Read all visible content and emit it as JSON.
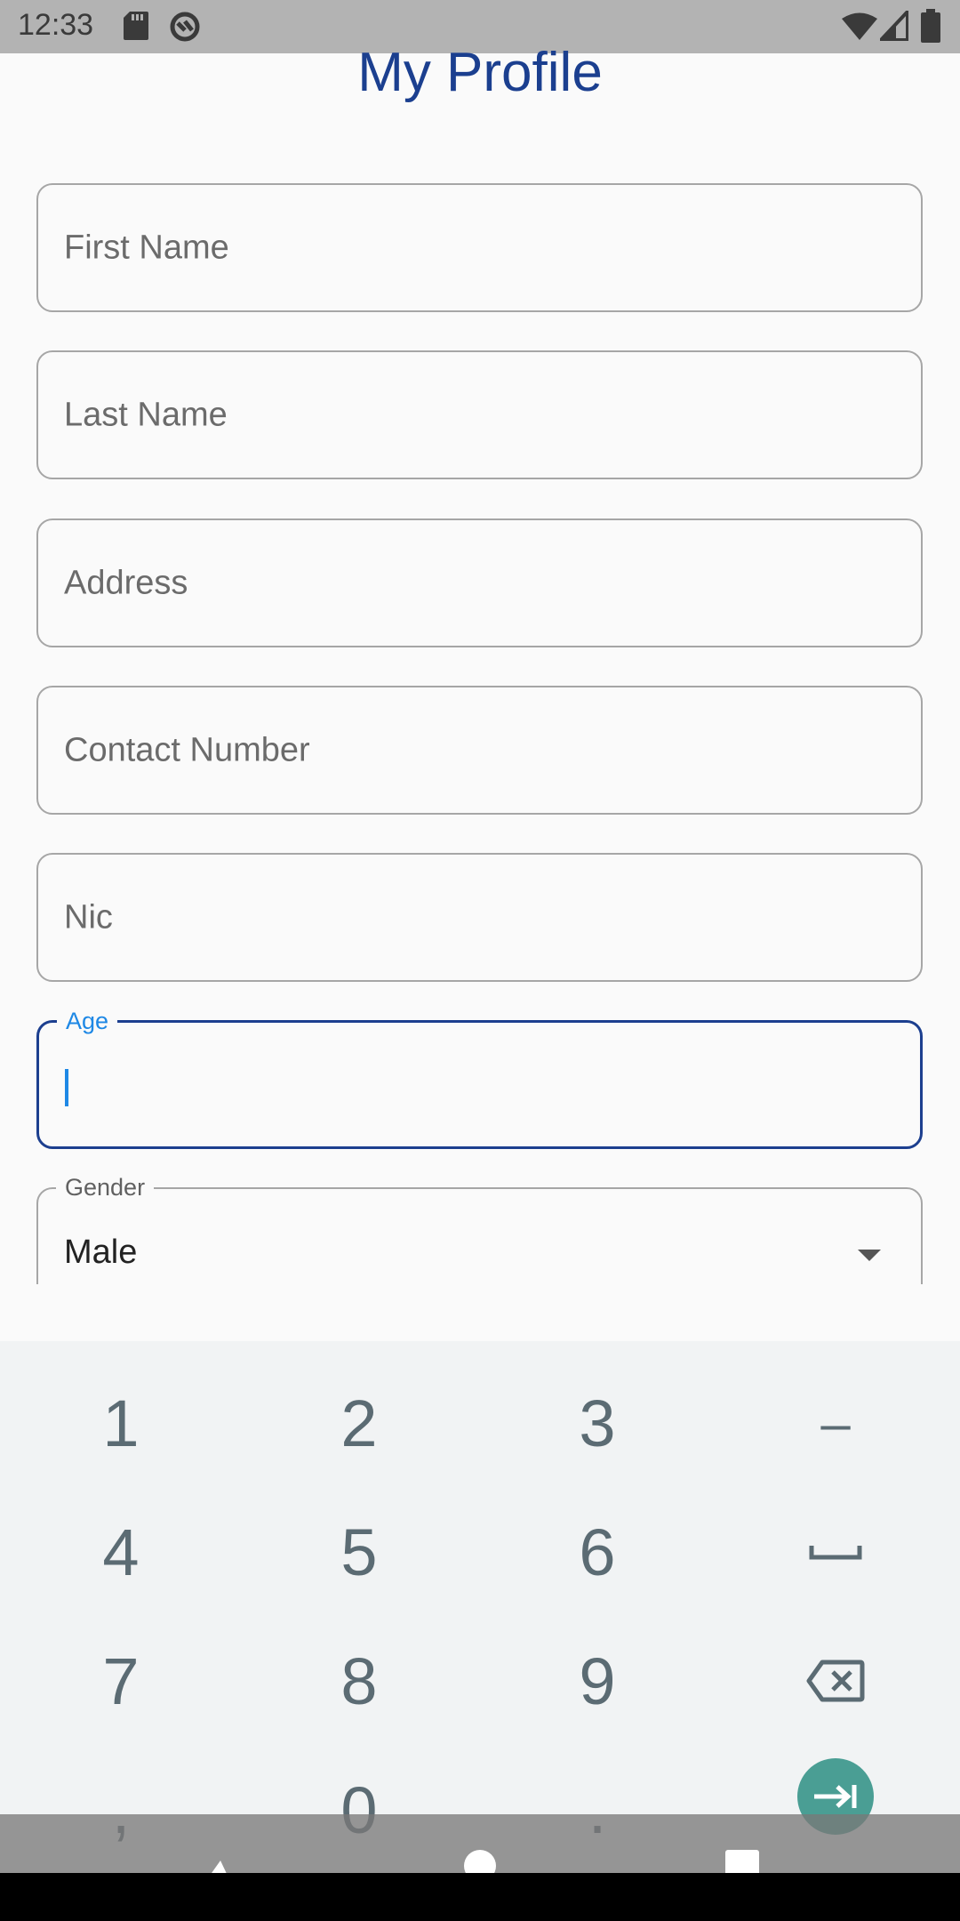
{
  "status_bar": {
    "time": "12:33",
    "icons": [
      "sd-card-icon",
      "sync-off-icon",
      "wifi-icon",
      "signal-icon",
      "battery-icon"
    ]
  },
  "page": {
    "title": "My Profile"
  },
  "form": {
    "first_name": {
      "placeholder": "First Name",
      "value": ""
    },
    "last_name": {
      "placeholder": "Last Name",
      "value": ""
    },
    "address": {
      "placeholder": "Address",
      "value": ""
    },
    "contact_number": {
      "placeholder": "Contact Number",
      "value": ""
    },
    "nic": {
      "placeholder": "Nic",
      "value": ""
    },
    "age": {
      "label": "Age",
      "value": ""
    },
    "gender": {
      "label": "Gender",
      "value": "Male"
    }
  },
  "keyboard": {
    "rows": [
      [
        "1",
        "2",
        "3",
        "–"
      ],
      [
        "4",
        "5",
        "6",
        "space-icon"
      ],
      [
        "7",
        "8",
        "9",
        "backspace-icon"
      ],
      [
        ",",
        "0",
        ".",
        "enter-icon"
      ]
    ],
    "accent_color": "#4a9e94"
  },
  "nav_bar": {
    "buttons": [
      "back-icon",
      "home-icon",
      "recents-icon"
    ]
  },
  "colors": {
    "title": "#1b3f8f",
    "focus_border": "#1c3f8f",
    "focus_label": "#1e88e5"
  }
}
